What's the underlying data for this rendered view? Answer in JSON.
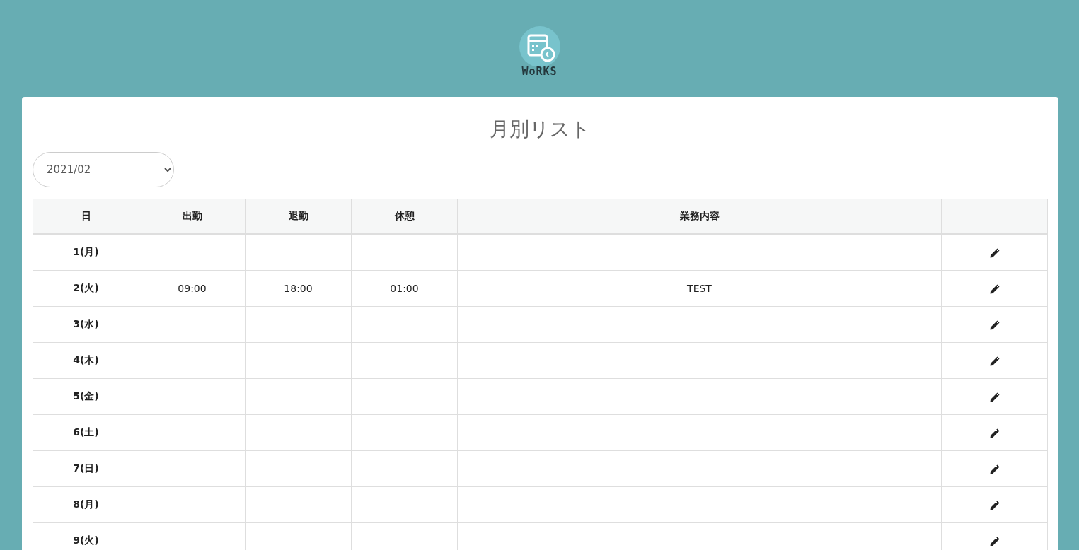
{
  "logo": {
    "text": "WoRKS"
  },
  "title": "月別リスト",
  "month_select": {
    "value": "2021/02"
  },
  "table": {
    "columns": [
      "日",
      "出勤",
      "退勤",
      "休憩",
      "業務内容"
    ],
    "rows": [
      {
        "day": "1(月)"
      },
      {
        "day": "2(火)",
        "start": "09:00",
        "end": "18:00",
        "break": "01:00",
        "work": "TEST"
      },
      {
        "day": "3(水)"
      },
      {
        "day": "4(木)"
      },
      {
        "day": "5(金)"
      },
      {
        "day": "6(土)"
      },
      {
        "day": "7(日)"
      },
      {
        "day": "8(月)"
      },
      {
        "day": "9(火)"
      }
    ]
  }
}
